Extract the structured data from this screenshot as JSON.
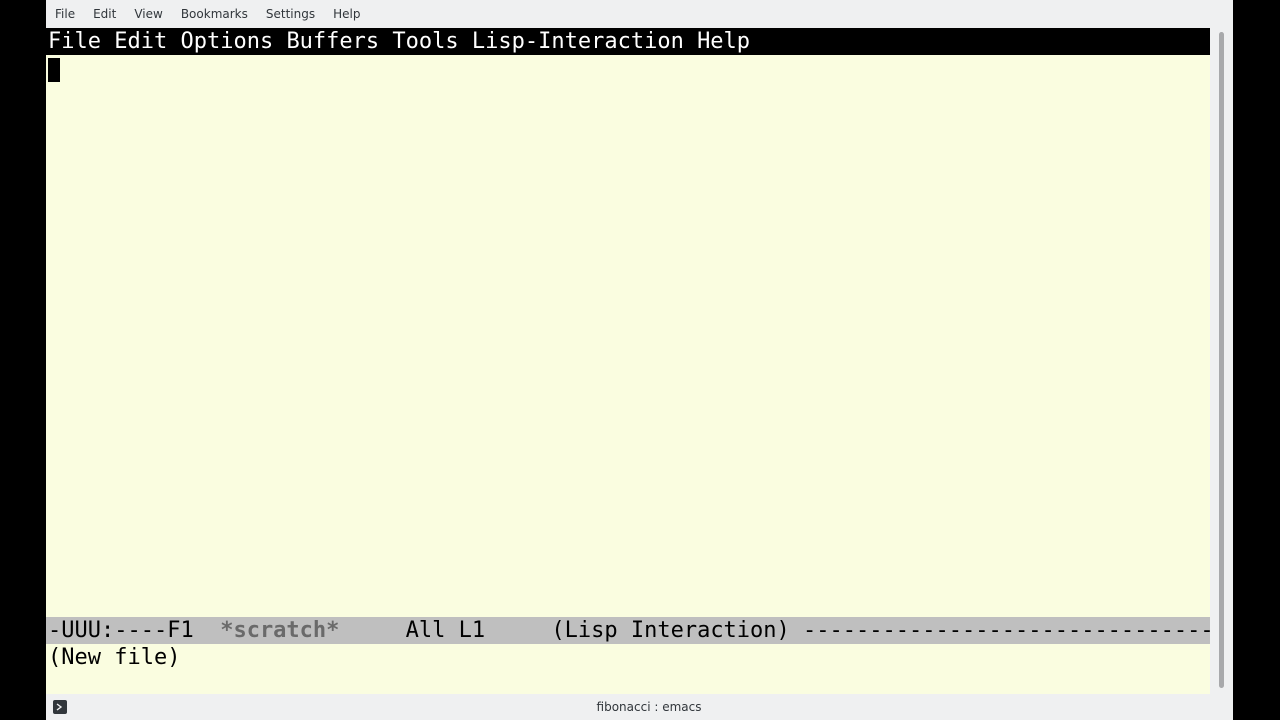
{
  "konsole_menu": [
    "File",
    "Edit",
    "View",
    "Bookmarks",
    "Settings",
    "Help"
  ],
  "emacs_menu": [
    "File",
    "Edit",
    "Options",
    "Buffers",
    "Tools",
    "Lisp-Interaction",
    "Help"
  ],
  "modeline": {
    "status": "-UUU:----F1",
    "buffer_name": "*scratch*",
    "position": "All L1",
    "mode": "(Lisp Interaction)",
    "fill": "----------------------------------------------------"
  },
  "minibuffer": "(New file)",
  "tab": {
    "title": "fibonacci : emacs",
    "icon": "terminal-prompt-icon"
  }
}
